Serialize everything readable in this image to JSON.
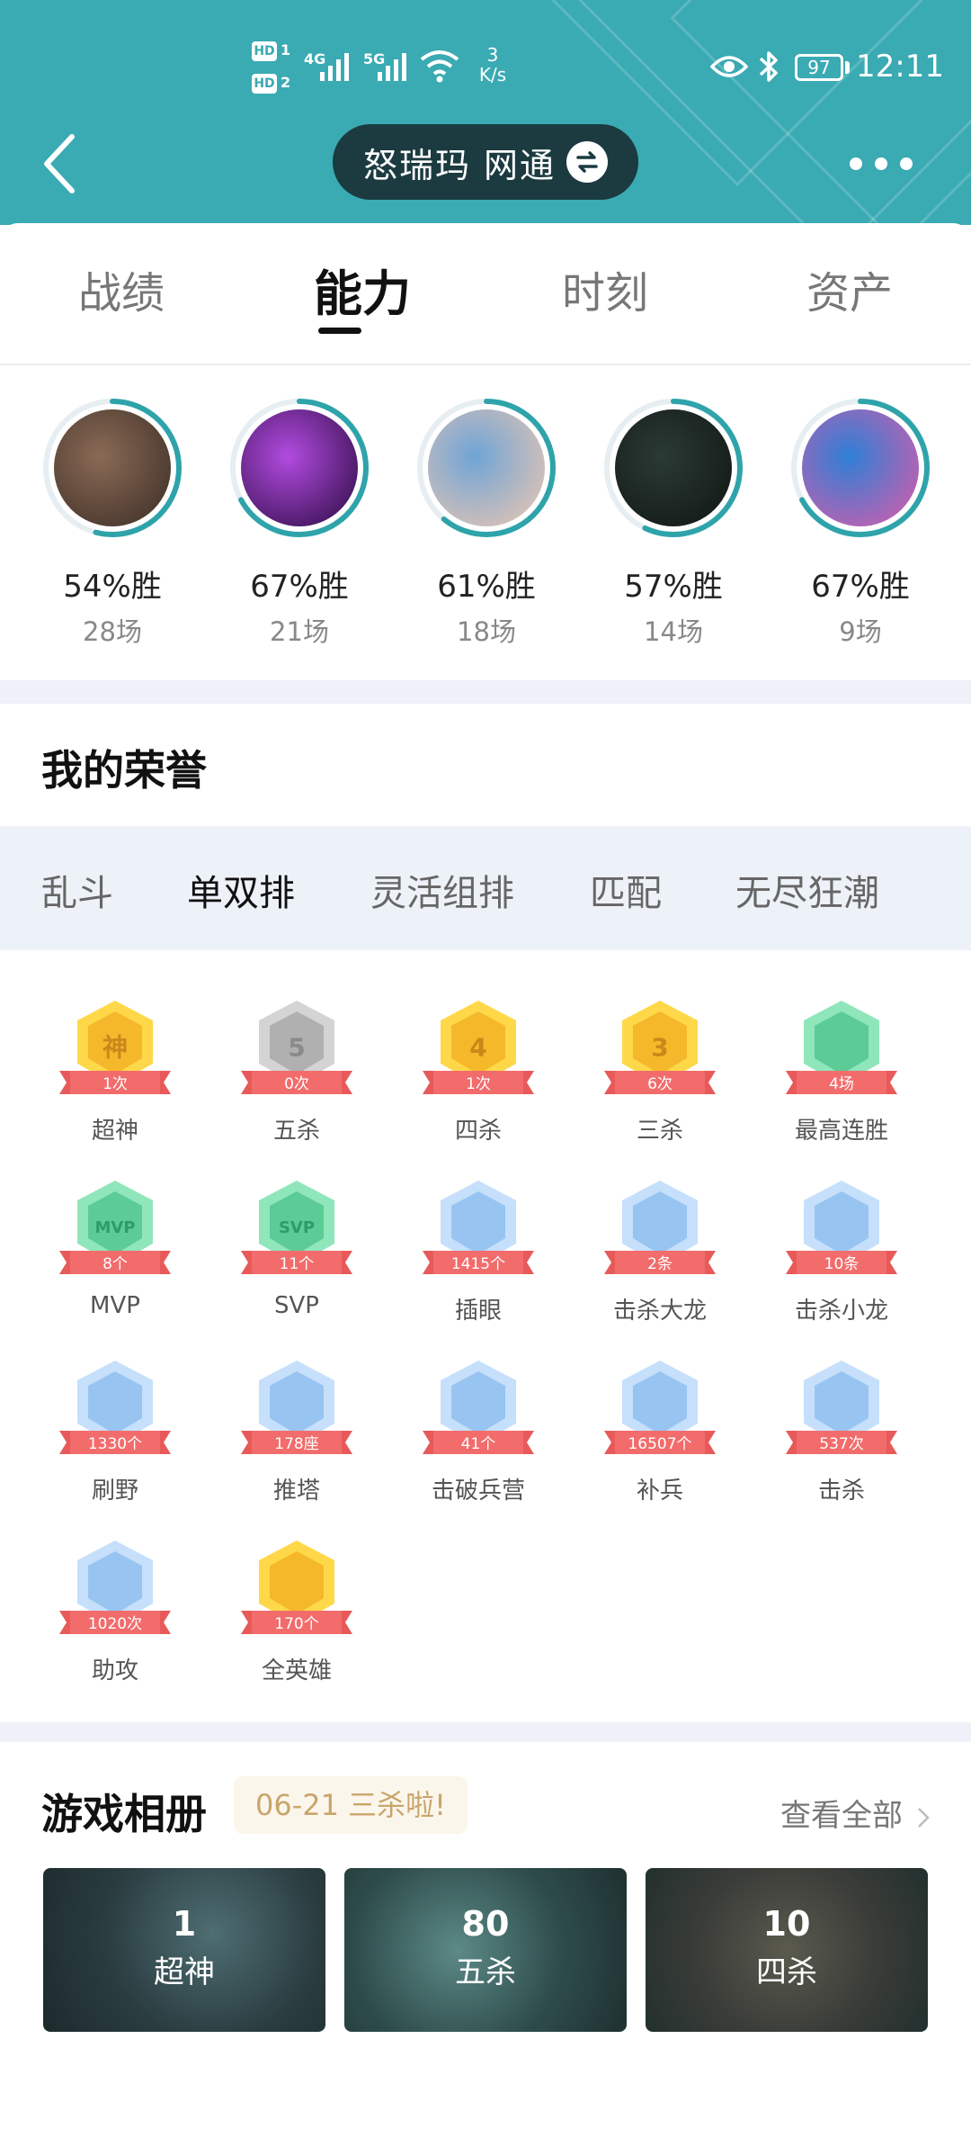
{
  "status_bar": {
    "hd1": "HD",
    "hd1_sub": "1",
    "hd2": "HD",
    "hd2_sub": "2",
    "net1": "4G",
    "net2": "5G",
    "speed_value": "3",
    "speed_unit": "K/s",
    "battery": "97",
    "time": "12:11"
  },
  "header": {
    "title": "怒瑞玛 网通"
  },
  "tabs": [
    {
      "label": "战绩"
    },
    {
      "label": "能力"
    },
    {
      "label": "时刻"
    },
    {
      "label": "资产"
    }
  ],
  "heroes": [
    {
      "winrate": "54%胜",
      "games": "28场"
    },
    {
      "winrate": "67%胜",
      "games": "21场"
    },
    {
      "winrate": "61%胜",
      "games": "18场"
    },
    {
      "winrate": "57%胜",
      "games": "14场"
    },
    {
      "winrate": "67%胜",
      "games": "9场"
    }
  ],
  "honors": {
    "title": "我的荣誉",
    "modes": [
      "乱斗",
      "单双排",
      "灵活组排",
      "匹配",
      "无尽狂潮"
    ],
    "badges": [
      {
        "glyph": "神",
        "count": "1次",
        "label": "超神",
        "color": "gold"
      },
      {
        "glyph": "5",
        "count": "0次",
        "label": "五杀",
        "color": "gray"
      },
      {
        "glyph": "4",
        "count": "1次",
        "label": "四杀",
        "color": "gold"
      },
      {
        "glyph": "3",
        "count": "6次",
        "label": "三杀",
        "color": "gold"
      },
      {
        "glyph": "",
        "count": "4场",
        "label": "最高连胜",
        "color": "green"
      },
      {
        "glyph": "MVP",
        "count": "8个",
        "label": "MVP",
        "color": "green"
      },
      {
        "glyph": "SVP",
        "count": "11个",
        "label": "SVP",
        "color": "green"
      },
      {
        "glyph": "",
        "count": "1415个",
        "label": "插眼",
        "color": "blue"
      },
      {
        "glyph": "",
        "count": "2条",
        "label": "击杀大龙",
        "color": "blue"
      },
      {
        "glyph": "",
        "count": "10条",
        "label": "击杀小龙",
        "color": "blue"
      },
      {
        "glyph": "",
        "count": "1330个",
        "label": "刷野",
        "color": "blue"
      },
      {
        "glyph": "",
        "count": "178座",
        "label": "推塔",
        "color": "blue"
      },
      {
        "glyph": "",
        "count": "41个",
        "label": "击破兵营",
        "color": "blue"
      },
      {
        "glyph": "",
        "count": "16507个",
        "label": "补兵",
        "color": "blue"
      },
      {
        "glyph": "",
        "count": "537次",
        "label": "击杀",
        "color": "blue"
      },
      {
        "glyph": "",
        "count": "1020次",
        "label": "助攻",
        "color": "blue"
      },
      {
        "glyph": "",
        "count": "170个",
        "label": "全英雄",
        "color": "gold"
      }
    ]
  },
  "album": {
    "title": "游戏相册",
    "tip": "06-21 三杀啦!",
    "view_all": "查看全部",
    "cards": [
      {
        "num": "1",
        "label": "超神"
      },
      {
        "num": "80",
        "label": "五杀"
      },
      {
        "num": "10",
        "label": "四杀"
      }
    ]
  },
  "colors": {
    "header_bg": "#3aaab3",
    "ring": "#2fa3aa",
    "badge_ribbon": "#f26c6c",
    "gold": "#f7c93a",
    "gray": "#bdbdbd",
    "green": "#6fd6a4",
    "blue": "#a9cdf5"
  }
}
